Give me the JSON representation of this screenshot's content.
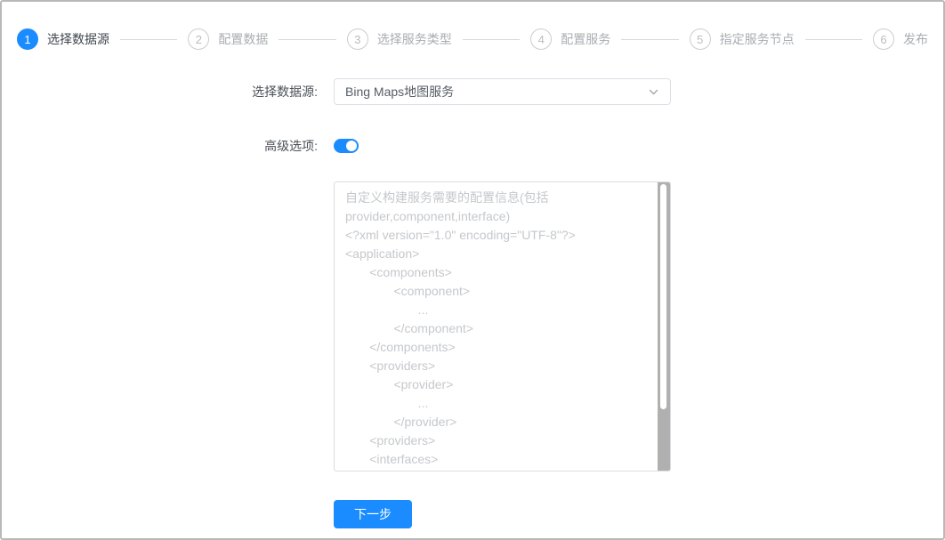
{
  "colors": {
    "accent": "#1a8cff",
    "window_border": "#b9b9b9",
    "connector_gray": "#d9d9d9",
    "placeholder_gray": "#c5c8cc",
    "scrollbar_track": "#b0b0b0"
  },
  "stepper": {
    "steps": [
      {
        "num": "1",
        "label": "选择数据源",
        "active": true
      },
      {
        "num": "2",
        "label": "配置数据",
        "active": false
      },
      {
        "num": "3",
        "label": "选择服务类型",
        "active": false
      },
      {
        "num": "4",
        "label": "配置服务",
        "active": false
      },
      {
        "num": "5",
        "label": "指定服务节点",
        "active": false
      },
      {
        "num": "6",
        "label": "发布",
        "active": false
      }
    ]
  },
  "form": {
    "datasource_label": "选择数据源:",
    "datasource_value": "Bing Maps地图服务",
    "advanced_label": "高级选项:",
    "advanced_on": true,
    "config_placeholder": "自定义构建服务需要的配置信息(包括\nprovider,component,interface)\n<?xml version=\"1.0\" encoding=\"UTF-8\"?>\n<application>\n       <components>\n              <component>\n                     ...\n              </component>\n       </components>\n       <providers>\n              <provider>\n                     ...\n              </provider>\n       <providers>\n       <interfaces>",
    "next_button_label": "下一步"
  }
}
